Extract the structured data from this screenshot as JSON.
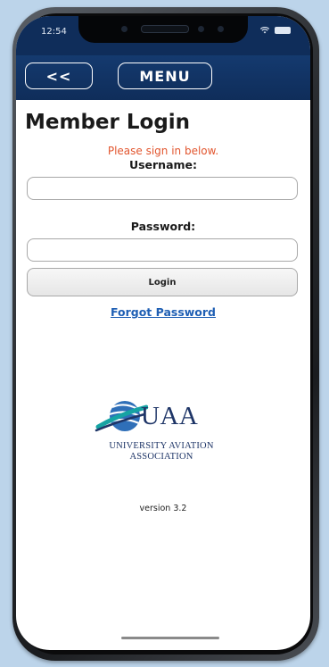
{
  "status": {
    "time": "12:54"
  },
  "nav": {
    "back_label": "<<",
    "menu_label": "MENU"
  },
  "login": {
    "title": "Member Login",
    "prompt": "Please sign in below.",
    "username_label": "Username:",
    "username_value": "",
    "password_label": "Password:",
    "password_value": "",
    "login_button": "Login",
    "forgot_link": "Forgot Password"
  },
  "logo": {
    "word": "UAA",
    "line1": "UNIVERSITY AVIATION",
    "line2": "ASSOCIATION"
  },
  "footer": {
    "version": "version 3.2"
  },
  "colors": {
    "nav_bg": "#0f2d5a",
    "prompt": "#e2562f",
    "link": "#1f5fb4"
  }
}
